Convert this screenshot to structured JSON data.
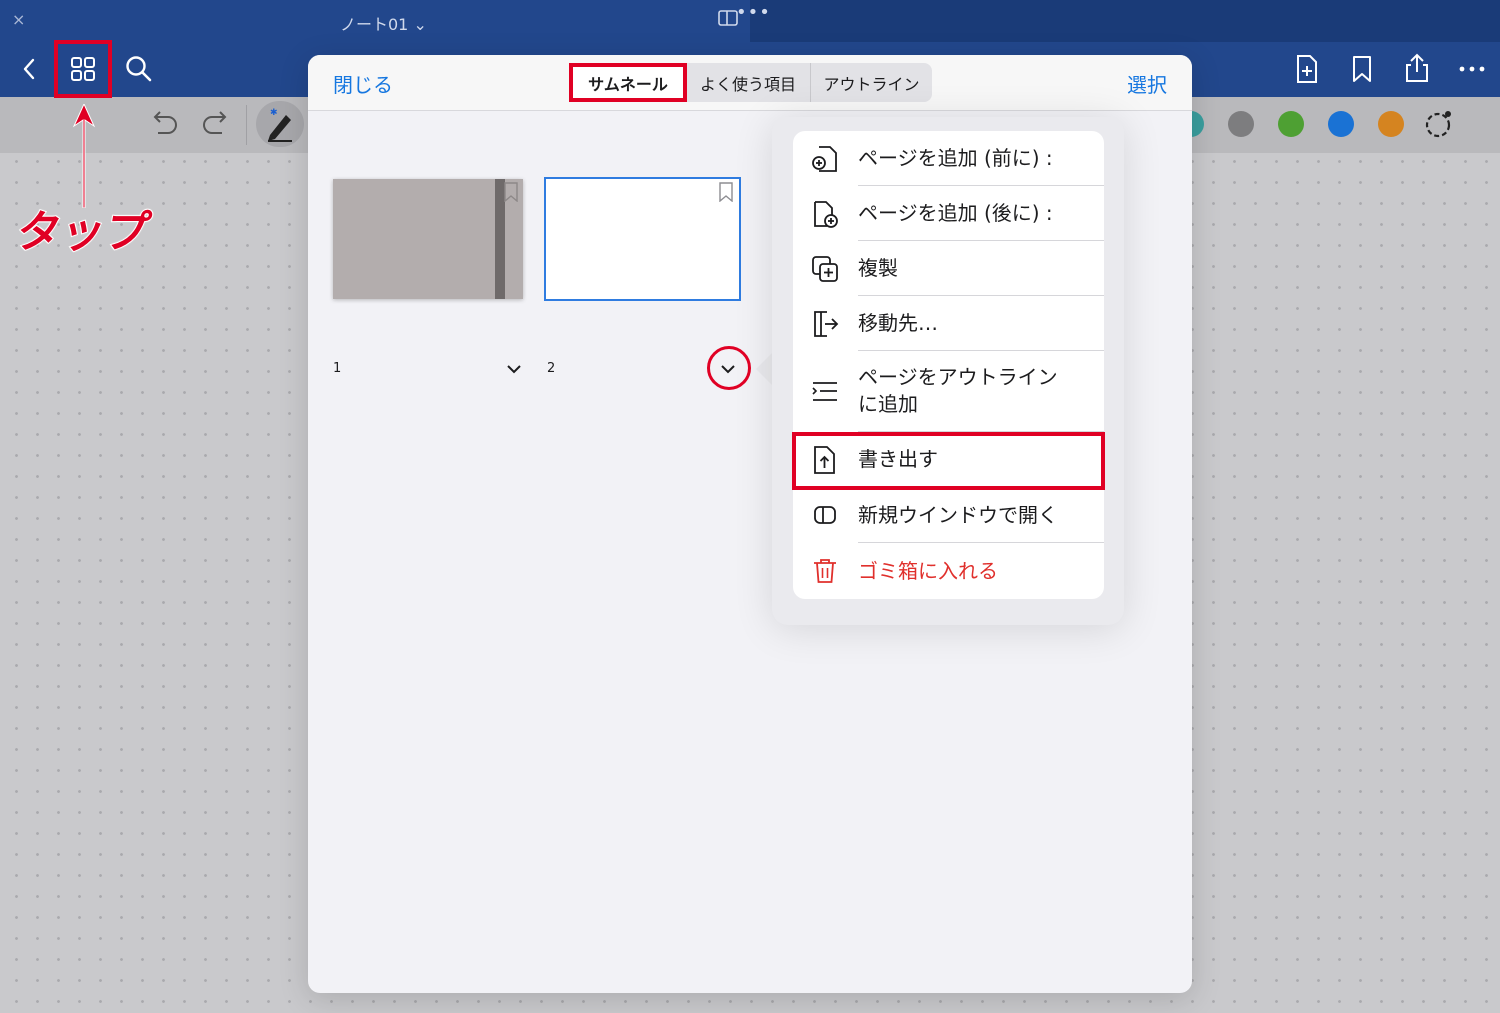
{
  "topbar": {
    "close_glyph": "×",
    "doc_title": "ノート01 ⌄",
    "dots": "•••",
    "icons": [
      "back-chevron-icon",
      "grid-icon",
      "search-icon",
      "add-page-icon",
      "bookmark-icon",
      "share-icon",
      "more-icon"
    ]
  },
  "toolbar": {
    "swatch_colors": [
      "#3a9e9e",
      "#7d7d7f",
      "#4ea033",
      "#1a72d4",
      "#d58420"
    ]
  },
  "annotation": {
    "tap_label": "タップ",
    "accent": "#e00024"
  },
  "panel": {
    "close_label": "閉じる",
    "select_label": "選択",
    "tabs": [
      {
        "label": "サムネール",
        "selected": true
      },
      {
        "label": "よく使う項目",
        "selected": false
      },
      {
        "label": "アウトライン",
        "selected": false
      }
    ],
    "pages": [
      {
        "number": "1"
      },
      {
        "number": "2"
      }
    ]
  },
  "menu": {
    "items": [
      {
        "label": "ページを追加 (前に) :",
        "icon": "page-add-before-icon"
      },
      {
        "label": "ページを追加 (後に) :",
        "icon": "page-add-after-icon"
      },
      {
        "label": "複製",
        "icon": "duplicate-icon"
      },
      {
        "label": "移動先…",
        "icon": "move-icon"
      },
      {
        "label": "ページをアウトライン",
        "label2": "に追加",
        "icon": "outline-list-icon"
      },
      {
        "label": "書き出す",
        "icon": "export-icon"
      },
      {
        "label": "新規ウインドウで開く",
        "icon": "new-window-icon"
      },
      {
        "label": "ゴミ箱に入れる",
        "icon": "trash-icon",
        "danger": true
      }
    ]
  },
  "colors": {
    "topbar": "#22478c",
    "link_blue": "#1677e0",
    "danger_red": "#e0302c"
  }
}
